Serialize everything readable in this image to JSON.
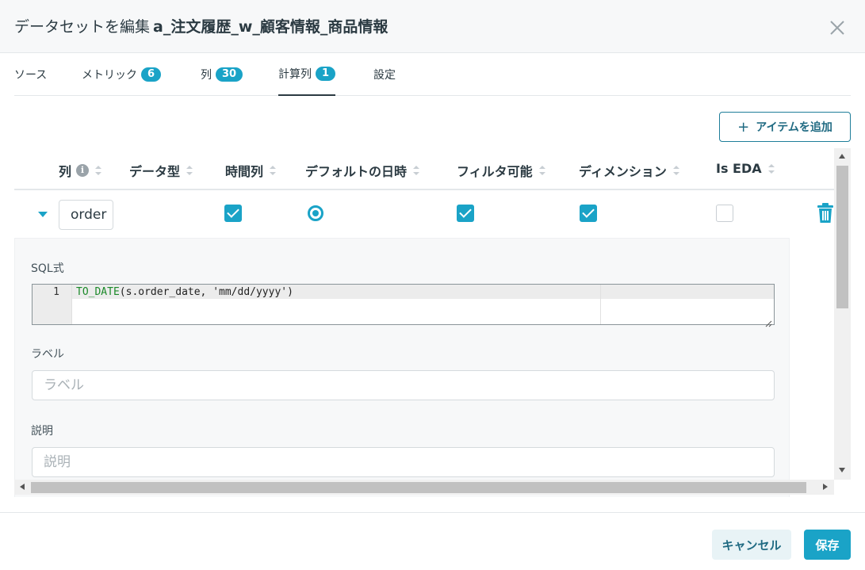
{
  "dialog": {
    "title_prefix": "データセットを編集",
    "dataset_name": "a_注文履歴_w_顧客情報_商品情報"
  },
  "tabs": [
    {
      "label": "ソース",
      "badge": null
    },
    {
      "label": "メトリック",
      "badge": "6"
    },
    {
      "label": "列",
      "badge": "30"
    },
    {
      "label": "計算列",
      "badge": "1",
      "active": true
    },
    {
      "label": "設定",
      "badge": null
    }
  ],
  "add_item_label": "アイテムを追加",
  "columns": [
    "列",
    "データ型",
    "時間列",
    "デフォルトの日時",
    "フィルタ可能",
    "ディメンション",
    "Is EDA"
  ],
  "row": {
    "name": "order",
    "is_time_column": true,
    "default_datetime": true,
    "filterable": true,
    "dimension": true,
    "is_eda": false
  },
  "detail": {
    "sql_label": "SQL式",
    "sql_line_number": "1",
    "sql_code": {
      "fn": "TO_DATE",
      "rest": "(s.order_date, 'mm/dd/yyyy')"
    },
    "label_label": "ラベル",
    "label_placeholder": "ラベル",
    "description_label": "説明",
    "description_placeholder": "説明"
  },
  "footer": {
    "cancel_label": "キャンセル",
    "save_label": "保存"
  },
  "colors": {
    "accent": "#1aa3c7",
    "text": "#2b3a42"
  }
}
